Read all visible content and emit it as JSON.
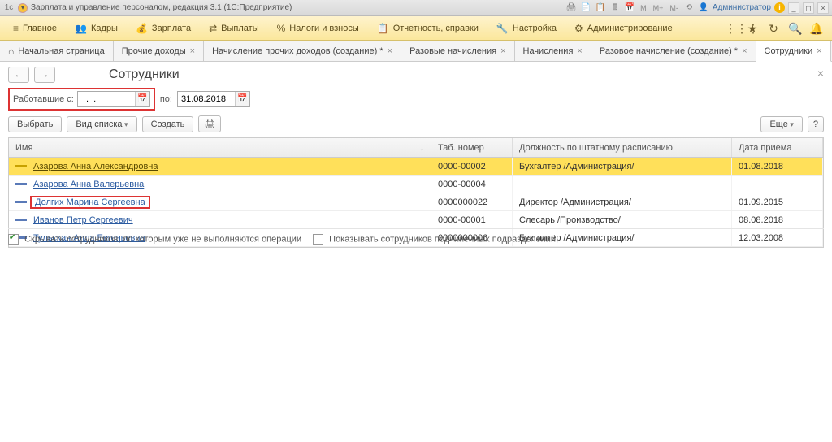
{
  "titlebar": {
    "title": "Зарплата и управление персоналом, редакция 3.1  (1С:Предприятие)",
    "mm_labels": [
      "M",
      "M+",
      "M-"
    ],
    "admin": "Администратор"
  },
  "menubar": {
    "items": [
      {
        "icon": "≡",
        "label": "Главное"
      },
      {
        "icon": "👥",
        "label": "Кадры"
      },
      {
        "icon": "💰",
        "label": "Зарплата"
      },
      {
        "icon": "⇄",
        "label": "Выплаты"
      },
      {
        "icon": "%",
        "label": "Налоги и взносы"
      },
      {
        "icon": "📋",
        "label": "Отчетность, справки"
      },
      {
        "icon": "🔧",
        "label": "Настройка"
      },
      {
        "icon": "⚙",
        "label": "Администрирование"
      }
    ]
  },
  "tabs": [
    {
      "label": "Начальная страница",
      "home": true,
      "closable": false,
      "dirty": false,
      "active": false
    },
    {
      "label": "Прочие доходы",
      "closable": true,
      "dirty": false,
      "active": false
    },
    {
      "label": "Начисление прочих доходов (создание)",
      "closable": true,
      "dirty": true,
      "active": false
    },
    {
      "label": "Разовые начисления",
      "closable": true,
      "dirty": false,
      "active": false
    },
    {
      "label": "Начисления",
      "closable": true,
      "dirty": false,
      "active": false
    },
    {
      "label": "Разовое начисление (создание)",
      "closable": true,
      "dirty": true,
      "active": false
    },
    {
      "label": "Сотрудники",
      "closable": true,
      "dirty": false,
      "active": true
    }
  ],
  "page": {
    "title": "Сотрудники",
    "filter": {
      "worked_from_label": "Работавшие с:",
      "worked_from_value": "  .  .    ",
      "to_label": "по:",
      "to_value": "31.08.2018"
    },
    "toolbar": {
      "select": "Выбрать",
      "view": "Вид списка",
      "create": "Создать",
      "print_icon": "🖨",
      "more": "Еще",
      "help": "?"
    },
    "columns": {
      "name": "Имя",
      "tab": "Таб. номер",
      "position": "Должность по штатному расписанию",
      "date": "Дата приема"
    },
    "rows": [
      {
        "name": "Азарова Анна Александровна",
        "tab": "0000-00002",
        "position": "Бухгалтер /Администрация/",
        "date": "01.08.2018",
        "selected": true,
        "highlighted": false
      },
      {
        "name": "Азарова Анна Валерьевна",
        "tab": "0000-00004",
        "position": "",
        "date": "",
        "selected": false,
        "highlighted": false
      },
      {
        "name": "Долгих Марина Сергеевна",
        "tab": "0000000022",
        "position": "Директор /Администрация/",
        "date": "01.09.2015",
        "selected": false,
        "highlighted": true
      },
      {
        "name": "Иванов Петр Сергеевич",
        "tab": "0000-00001",
        "position": "Слесарь /Производство/",
        "date": "08.08.2018",
        "selected": false,
        "highlighted": false
      },
      {
        "name": "Тульская Алла Евгеньевна",
        "tab": "0000000006",
        "position": "Бухгалтер /Администрация/",
        "date": "12.03.2008",
        "selected": false,
        "highlighted": false
      }
    ],
    "bottom": {
      "hide_label": "Скрывать сотрудников, по которым уже не выполняются операции",
      "hide_checked": true,
      "show_sub_label": "Показывать сотрудников подчиненных подразделений",
      "show_sub_checked": false
    }
  }
}
